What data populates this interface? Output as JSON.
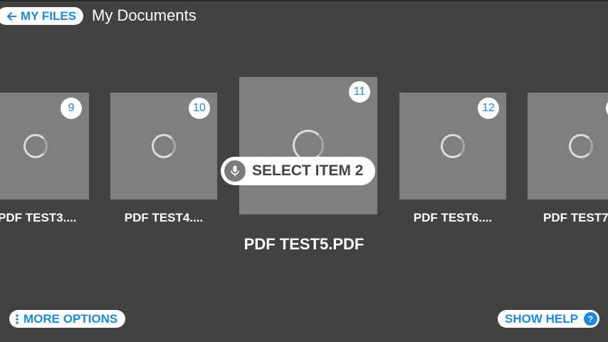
{
  "header": {
    "back_label": "MY FILES",
    "title": "My Documents"
  },
  "voice_prompt": {
    "label": "SELECT ITEM 2"
  },
  "items": [
    {
      "number": "9",
      "label": "PDF TEST3...."
    },
    {
      "number": "10",
      "label": "PDF TEST4...."
    },
    {
      "number": "11",
      "label": "PDF TEST5.PDF"
    },
    {
      "number": "12",
      "label": "PDF TEST6...."
    },
    {
      "number": "",
      "label": "PDF TEST7"
    }
  ],
  "footer": {
    "more_options_label": "MORE OPTIONS",
    "show_help_label": "SHOW HELP",
    "help_glyph": "?"
  },
  "colors": {
    "background": "#424242",
    "tile": "#7f7f7f",
    "accent": "#1e88e5"
  }
}
